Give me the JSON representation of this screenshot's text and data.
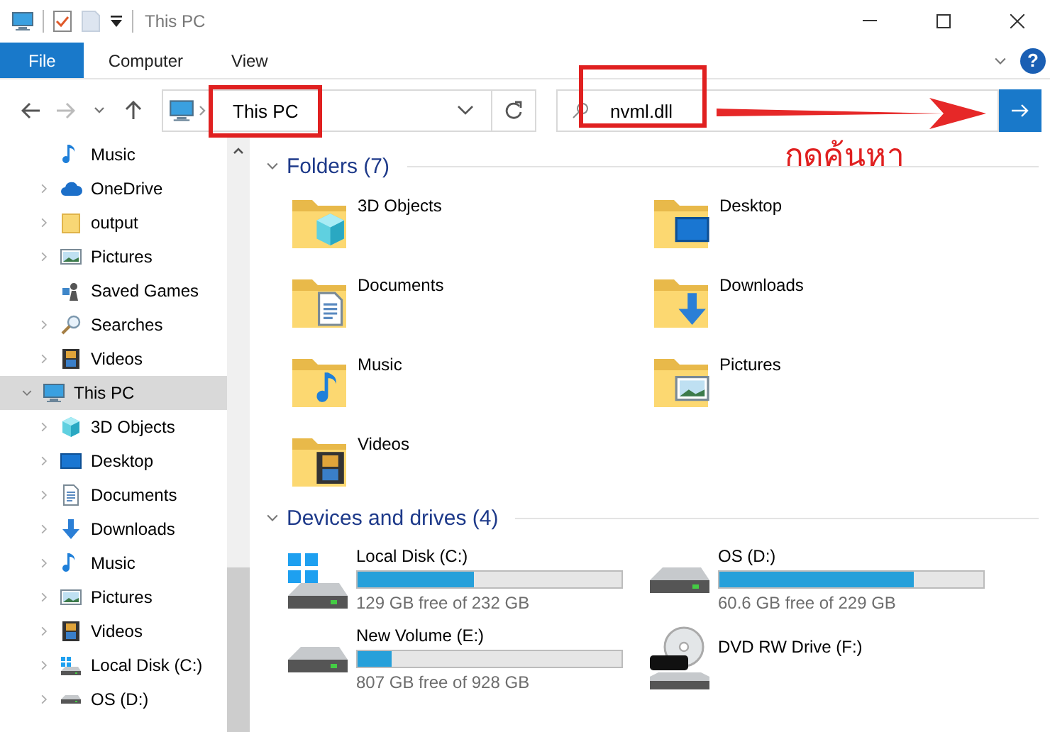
{
  "window": {
    "title": "This PC"
  },
  "ribbon": {
    "tabs": [
      {
        "label": "File",
        "selected": true
      },
      {
        "label": "Computer",
        "selected": false
      },
      {
        "label": "View",
        "selected": false
      }
    ],
    "help": "?"
  },
  "address": {
    "location": "This PC",
    "highlighted": true
  },
  "search": {
    "value": "nvml.dll",
    "highlighted": true
  },
  "annotation_note": "กดค้นหา",
  "sidebar": {
    "partial_group": [
      {
        "label": "Music",
        "kind": "music",
        "expandable": false
      },
      {
        "label": "OneDrive",
        "kind": "onedrive",
        "expandable": true
      },
      {
        "label": "output",
        "kind": "folder",
        "expandable": true
      },
      {
        "label": "Pictures",
        "kind": "pictures",
        "expandable": true
      },
      {
        "label": "Saved Games",
        "kind": "games",
        "expandable": false
      },
      {
        "label": "Searches",
        "kind": "searches",
        "expandable": true
      },
      {
        "label": "Videos",
        "kind": "videos",
        "expandable": true
      }
    ],
    "items": [
      {
        "label": "This PC",
        "kind": "pc",
        "expandable": true,
        "expanded": true,
        "selected": true,
        "children": [
          {
            "label": "3D Objects",
            "kind": "objects",
            "expandable": true,
            "selected": false
          },
          {
            "label": "Desktop",
            "kind": "desktop",
            "expandable": true,
            "selected": false
          },
          {
            "label": "Documents",
            "kind": "documents",
            "expandable": true,
            "selected": false
          },
          {
            "label": "Downloads",
            "kind": "downloads",
            "expandable": true,
            "selected": false
          },
          {
            "label": "Music",
            "kind": "music",
            "expandable": true,
            "selected": false
          },
          {
            "label": "Pictures",
            "kind": "pictures",
            "expandable": true,
            "selected": false
          },
          {
            "label": "Videos",
            "kind": "videos",
            "expandable": true,
            "selected": false
          },
          {
            "label": "Local Disk (C:)",
            "kind": "system",
            "expandable": true,
            "selected": false
          },
          {
            "label": "OS (D:)",
            "kind": "disk",
            "expandable": true,
            "selected": false
          }
        ]
      }
    ]
  },
  "folders": {
    "title": "Folders (7)",
    "expanded": true,
    "items": [
      {
        "label": "3D Objects",
        "kind": "objects"
      },
      {
        "label": "Desktop",
        "kind": "desktop"
      },
      {
        "label": "Documents",
        "kind": "documents"
      },
      {
        "label": "Downloads",
        "kind": "downloads"
      },
      {
        "label": "Music",
        "kind": "music"
      },
      {
        "label": "Pictures",
        "kind": "pictures"
      },
      {
        "label": "Videos",
        "kind": "videos"
      }
    ]
  },
  "drives": {
    "title": "Devices and drives (4)",
    "expanded": true,
    "items": [
      {
        "label": "Local Disk (C:)",
        "kind": "system",
        "level": 0.44,
        "free": "129 GB free of 232 GB"
      },
      {
        "label": "OS (D:)",
        "kind": "disk",
        "level": 0.735,
        "free": "60.6 GB free of 229 GB"
      },
      {
        "label": "New Volume (E:)",
        "kind": "disk",
        "level": 0.13,
        "free": "807 GB free of 928 GB"
      },
      {
        "label": "DVD RW Drive (F:)",
        "kind": "dvd"
      }
    ]
  }
}
